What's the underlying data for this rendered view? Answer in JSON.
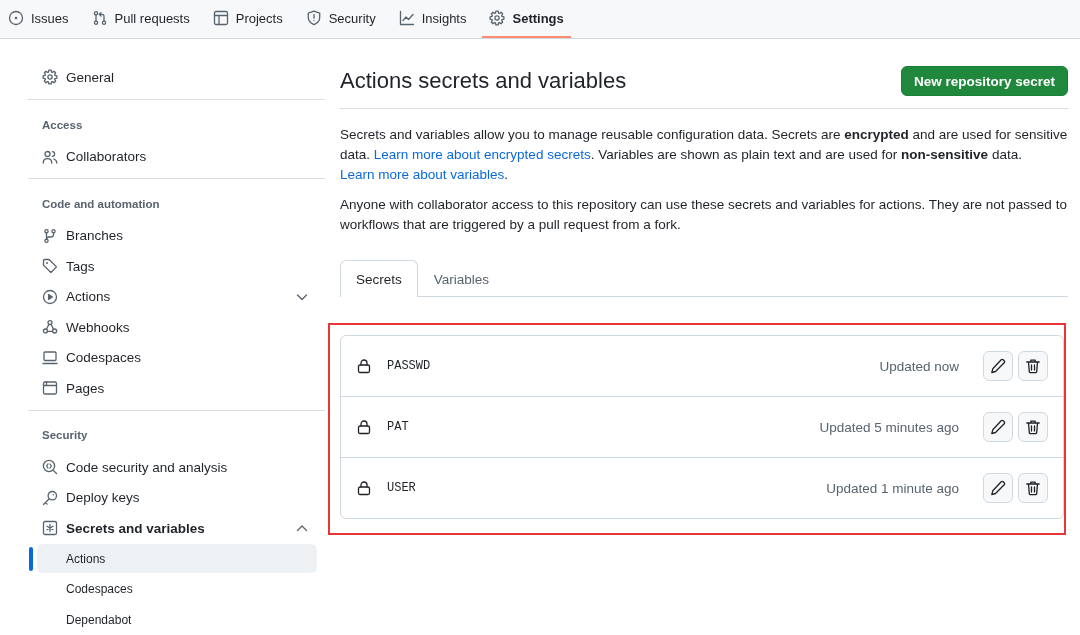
{
  "repo_nav": [
    {
      "label": "Issues",
      "selected": false
    },
    {
      "label": "Pull requests",
      "selected": false
    },
    {
      "label": "Projects",
      "selected": false
    },
    {
      "label": "Security",
      "selected": false
    },
    {
      "label": "Insights",
      "selected": false
    },
    {
      "label": "Settings",
      "selected": true
    }
  ],
  "sidebar": {
    "items": [
      {
        "label": "General",
        "selected": false
      }
    ],
    "sections": [
      {
        "heading": "Access",
        "items": [
          {
            "label": "Collaborators",
            "selected": false
          }
        ]
      },
      {
        "heading": "Code and automation",
        "items": [
          {
            "label": "Branches",
            "selected": false
          },
          {
            "label": "Tags",
            "selected": false
          },
          {
            "label": "Actions",
            "selected": false,
            "expanded": false
          },
          {
            "label": "Webhooks",
            "selected": false
          },
          {
            "label": "Codespaces",
            "selected": false
          },
          {
            "label": "Pages",
            "selected": false
          }
        ]
      },
      {
        "heading": "Security",
        "items": [
          {
            "label": "Code security and analysis",
            "selected": false
          },
          {
            "label": "Deploy keys",
            "selected": false
          },
          {
            "label": "Secrets and variables",
            "selected": false,
            "expanded": true,
            "children": [
              {
                "label": "Actions",
                "selected": true
              },
              {
                "label": "Codespaces",
                "selected": false
              },
              {
                "label": "Dependabot",
                "selected": false
              }
            ]
          }
        ]
      }
    ]
  },
  "main": {
    "title": "Actions secrets and variables",
    "new_button": "New repository secret",
    "paragraphs": [
      [
        {
          "kind": "text",
          "text": "Secrets and variables allow you to manage reusable configuration data. Secrets are **encrypted** and are used for sensitive data. "
        },
        {
          "kind": "link",
          "text": "Learn more about encrypted secrets"
        },
        {
          "kind": "text",
          "text": ". Variables are shown as plain text and are used for **non-sensitive** data. "
        },
        {
          "kind": "link",
          "text": "Learn more about variables"
        },
        {
          "kind": "text",
          "text": "."
        }
      ],
      [
        {
          "kind": "text",
          "text": "Anyone with collaborator access to this repository can use these secrets and variables for actions. They are not passed to workflows that are triggered by a pull request from a fork."
        }
      ]
    ],
    "tabs": [
      {
        "label": "Secrets",
        "selected": true
      },
      {
        "label": "Variables",
        "selected": false
      }
    ],
    "secrets": {
      "highlighted": true,
      "items": [
        {
          "name": "PASSWD",
          "updated": "Updated now"
        },
        {
          "name": "PAT",
          "updated": "Updated 5 minutes ago"
        },
        {
          "name": "USER",
          "updated": "Updated 1 minute ago"
        }
      ]
    }
  }
}
